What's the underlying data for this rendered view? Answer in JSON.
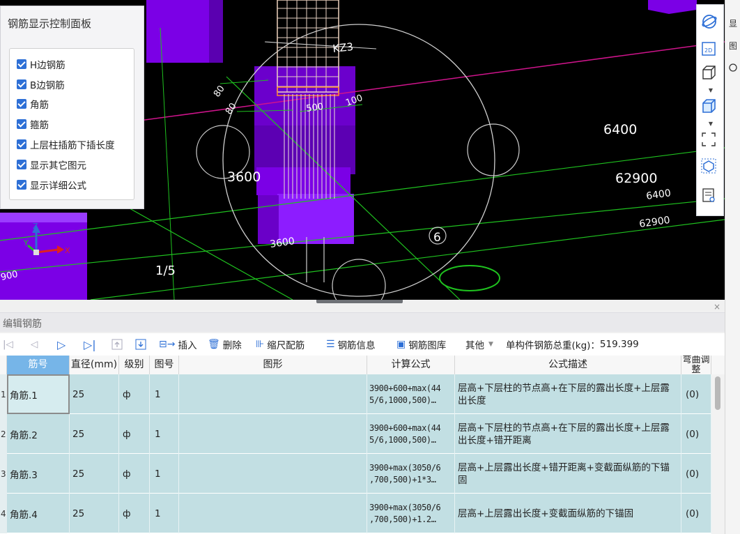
{
  "viewport": {
    "labels": {
      "col_label": "KZ3",
      "dim_500": "500",
      "dim_100": "100",
      "dim_left_a": "80",
      "dim_left_b": "80",
      "dim_3600_a": "3600",
      "dim_3600_b": "3600",
      "dim_6400_a": "6400",
      "dim_6400_b": "6400",
      "dim_62900_a": "62900",
      "dim_62900_b": "62900",
      "axis_6": "6",
      "axis_1_5": "1/5",
      "left_900": "900"
    }
  },
  "control_panel": {
    "title": "钢筋显示控制面板",
    "options": [
      {
        "label": "H边钢筋",
        "checked": true
      },
      {
        "label": "B边钢筋",
        "checked": true
      },
      {
        "label": "角筋",
        "checked": true
      },
      {
        "label": "箍筋",
        "checked": true
      },
      {
        "label": "上层柱插筋下插长度",
        "checked": true
      },
      {
        "label": "显示其它图元",
        "checked": true
      },
      {
        "label": "显示详细公式",
        "checked": true
      }
    ]
  },
  "right_toolbar": {
    "icons": [
      "orbit-icon",
      "view-2d-icon",
      "view-3d-box-icon",
      "view-3d-solid-icon",
      "fit-view-icon",
      "element-view-icon",
      "display-settings-icon"
    ],
    "view_2d_label": "2D"
  },
  "right_strip": {
    "items": [
      "显",
      "图"
    ]
  },
  "editor": {
    "title": "编辑钢筋",
    "close": "×"
  },
  "toolbar": {
    "insert": "插入",
    "delete": "删除",
    "scale": "缩尺配筋",
    "info": "钢筋信息",
    "library": "钢筋图库",
    "other": "其他",
    "total_label": "单构件钢筋总重(kg)：",
    "total_value": "519.399"
  },
  "grid": {
    "headers": [
      "筋号",
      "直径(mm)",
      "级别",
      "图号",
      "图形",
      "计算公式",
      "公式描述",
      "弯曲调整"
    ],
    "rows": [
      {
        "num": "1",
        "name": "角筋.1",
        "diameter": "25",
        "grade": "ф",
        "fig": "1",
        "formula1": "3900+600+max(44",
        "formula2": "5/6,1000,500)…",
        "desc": "层高+下层柱的节点高+在下层的露出长度+上层露出长度",
        "bend": "(0)"
      },
      {
        "num": "2",
        "name": "角筋.2",
        "diameter": "25",
        "grade": "ф",
        "fig": "1",
        "formula1": "3900+600+max(44",
        "formula2": "5/6,1000,500)…",
        "desc": "层高+下层柱的节点高+在下层的露出长度+上层露出长度+错开距离",
        "bend": "(0)"
      },
      {
        "num": "3",
        "name": "角筋.3",
        "diameter": "25",
        "grade": "ф",
        "fig": "1",
        "formula1": "3900+max(3050/6",
        "formula2": ",700,500)+1*3…",
        "desc": "层高+上层露出长度+错开距离+变截面纵筋的下锚固",
        "bend": "(0)"
      },
      {
        "num": "4",
        "name": "角筋.4",
        "diameter": "25",
        "grade": "ф",
        "fig": "1",
        "formula1": "3900+max(3050/6",
        "formula2": ",700,500)+1.2…",
        "desc": "层高+上层露出长度+变截面纵筋的下锚固",
        "bend": "(0)"
      }
    ]
  }
}
